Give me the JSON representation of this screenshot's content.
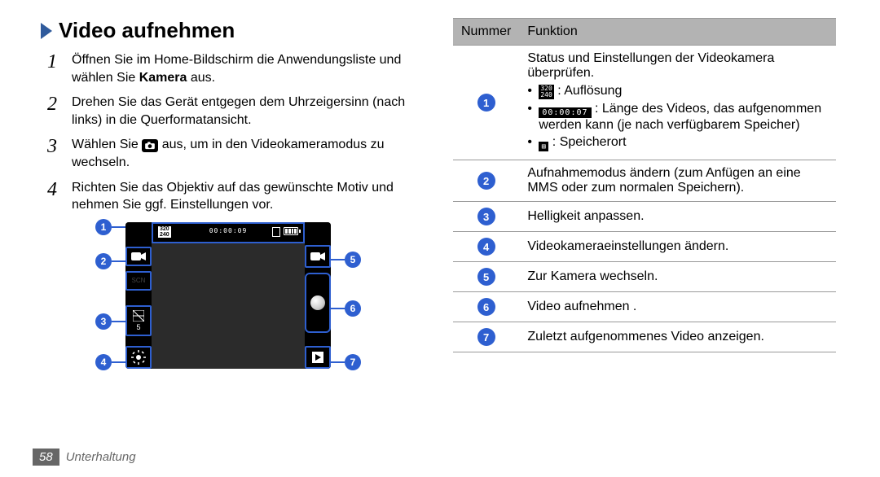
{
  "footer": {
    "page_number": "58",
    "section_name": "Unterhaltung"
  },
  "heading": "Video aufnehmen",
  "steps": [
    {
      "num": "1",
      "html": "Öffnen Sie im Home-Bildschirm die Anwendungsliste und wählen Sie <b>Kamera</b> aus."
    },
    {
      "num": "2",
      "html": "Drehen Sie das Gerät entgegen dem Uhrzeigersinn (nach links) in die Querformatansicht."
    },
    {
      "num": "3",
      "html": "Wählen Sie [icon] aus, um in den Videokameramodus zu wechseln."
    },
    {
      "num": "4",
      "html": "Richten Sie das Objektiv auf das gewünschte Motiv und nehmen Sie ggf. Einstellungen vor."
    }
  ],
  "camera_preview": {
    "resolution_badge": {
      "top": "320",
      "bottom": "240"
    },
    "timecode": "00:00:09"
  },
  "table": {
    "headers": [
      "Nummer",
      "Funktion"
    ],
    "rows": [
      {
        "num": "1",
        "intro": "Status und Einstellungen der Videokamera überprüfen.",
        "bullets": [
          {
            "icon": "resolution",
            "text": ": Auflösung"
          },
          {
            "icon": "timecode",
            "text": ": Länge des Videos, das aufgenommen werden kann (je nach verfügbarem Speicher)"
          },
          {
            "icon": "storage",
            "text": ": Speicherort"
          }
        ]
      },
      {
        "num": "2",
        "text": "Aufnahmemodus ändern (zum Anfügen an eine MMS oder zum normalen Speichern)."
      },
      {
        "num": "3",
        "text": "Helligkeit anpassen."
      },
      {
        "num": "4",
        "text": "Videokameraeinstellungen ändern."
      },
      {
        "num": "5",
        "text": "Zur Kamera wechseln."
      },
      {
        "num": "6",
        "text": "Video aufnehmen ."
      },
      {
        "num": "7",
        "text": "Zuletzt aufgenommenes Video anzeigen."
      }
    ]
  }
}
